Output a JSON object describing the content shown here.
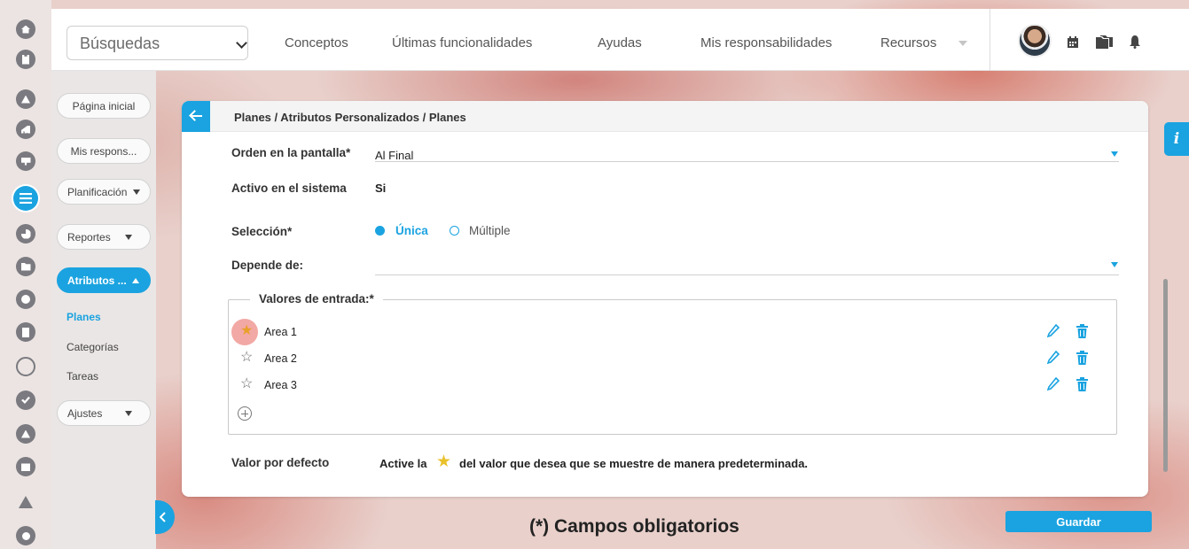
{
  "header": {
    "search_label": "Búsquedas",
    "nav": [
      "Conceptos",
      "Últimas funcionalidades",
      "Ayudas",
      "Mis responsabilidades",
      "Recursos"
    ]
  },
  "sidebar": {
    "home": "Página inicial",
    "responsibilities": "Mis respons...",
    "planning": "Planificación",
    "reports": "Reportes",
    "attributes": "Atributos ...",
    "sub_items": [
      "Planes",
      "Categorías",
      "Tareas"
    ],
    "settings": "Ajustes"
  },
  "page": {
    "breadcrumb": "Planes / Atributos Personalizados / Planes",
    "order_label": "Orden en la pantalla*",
    "order_value": "Al Final",
    "active_label": "Activo en el sistema",
    "active_value": "Si",
    "selection_label": "Selección*",
    "selection_single": "Única",
    "selection_multiple": "Múltiple",
    "selection_value": "Única",
    "depends_label": "Depende de:",
    "depends_value": "",
    "values_legend": "Valores de entrada:*",
    "values": [
      {
        "label": "Area 1",
        "default": true
      },
      {
        "label": "Area 2",
        "default": false
      },
      {
        "label": "Area 3",
        "default": false
      }
    ],
    "default_label": "Valor por defecto",
    "default_help_prefix": "Active la",
    "default_help_suffix": "del valor que desea que se muestre de manera predeterminada.",
    "required_note": "(*) Campos obligatorios",
    "save": "Guardar",
    "info": "i"
  },
  "colors": {
    "accent": "#1aa3e0",
    "star_active": "#e9a02a",
    "icon_bar": "#7a7a80"
  },
  "icons": [
    "home-icon",
    "tower-icon",
    "triangle-icon",
    "chart-icon",
    "monitor-icon",
    "plans-icon",
    "pie-icon",
    "folder-icon",
    "clock-icon",
    "document-icon",
    "cycle-icon",
    "check-icon",
    "alert-icon",
    "calendar-icon",
    "network-icon",
    "gear-icon"
  ]
}
